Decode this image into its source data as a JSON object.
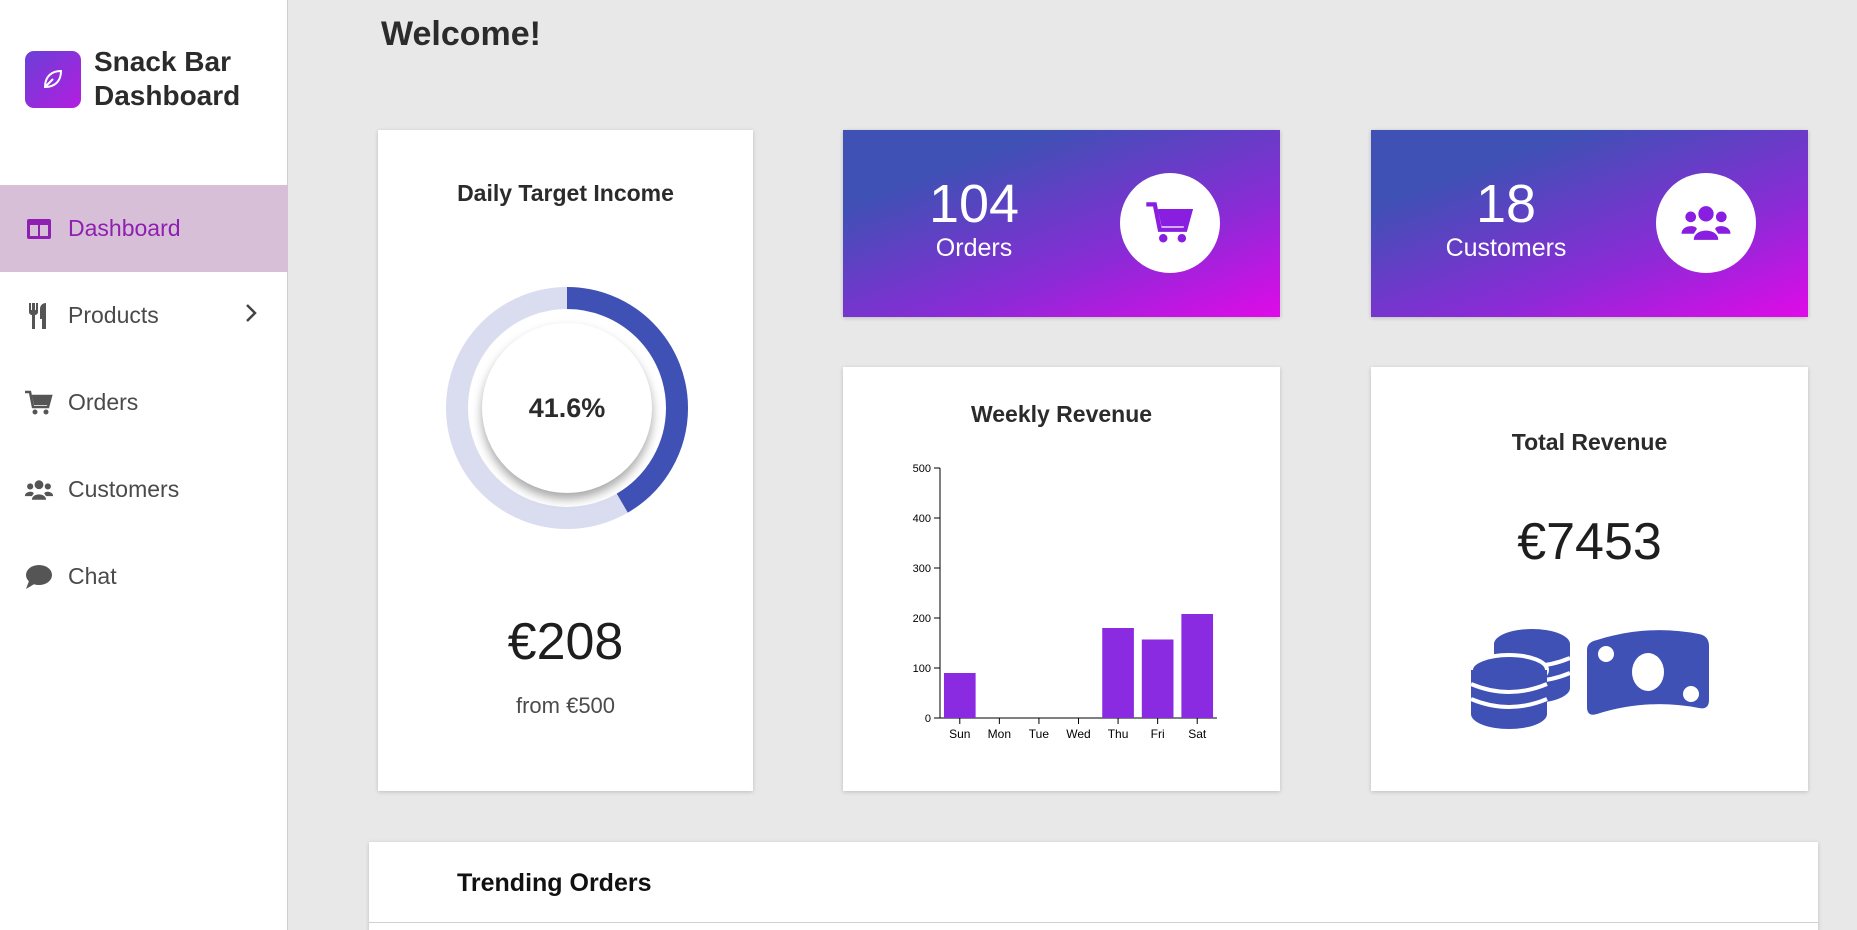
{
  "brand": {
    "title_line1": "Snack Bar",
    "title_line2": "Dashboard",
    "logo_icon": "leaf-icon"
  },
  "nav": {
    "items": [
      {
        "label": "Dashboard",
        "icon": "layout-icon",
        "active": true
      },
      {
        "label": "Products",
        "icon": "utensils-icon",
        "has_submenu": true
      },
      {
        "label": "Orders",
        "icon": "cart-icon"
      },
      {
        "label": "Customers",
        "icon": "users-icon"
      },
      {
        "label": "Chat",
        "icon": "chat-bubble-icon"
      }
    ]
  },
  "welcome": "Welcome!",
  "daily_target": {
    "title": "Daily Target Income",
    "percent_label": "41.6%",
    "progress": 0.416,
    "amount": "€208",
    "from": "from €500"
  },
  "orders_stat": {
    "value": "104",
    "label": "Orders",
    "icon": "cart-icon"
  },
  "customers_stat": {
    "value": "18",
    "label": "Customers",
    "icon": "users-icon"
  },
  "weekly_revenue": {
    "title": "Weekly Revenue"
  },
  "total_revenue": {
    "title": "Total Revenue",
    "amount": "€7453",
    "icons": [
      "coins-icon",
      "money-bill-icon"
    ]
  },
  "trending": {
    "title": "Trending Orders"
  },
  "colors": {
    "accent_blue": "#3f51b5",
    "accent_purple": "#8a2be2",
    "accent_magenta": "#e00ae8",
    "nav_active_bg": "#d8bfd8"
  },
  "chart_data": {
    "type": "bar",
    "title": "Weekly Revenue",
    "categories": [
      "Sun",
      "Mon",
      "Tue",
      "Wed",
      "Thu",
      "Fri",
      "Sat"
    ],
    "values": [
      90,
      0,
      0,
      0,
      180,
      157,
      208
    ],
    "ylim": [
      0,
      500
    ],
    "yticks": [
      "0",
      "100",
      "200",
      "300",
      "400",
      "500"
    ],
    "bar_color": "#8a2be2",
    "grid": false
  }
}
